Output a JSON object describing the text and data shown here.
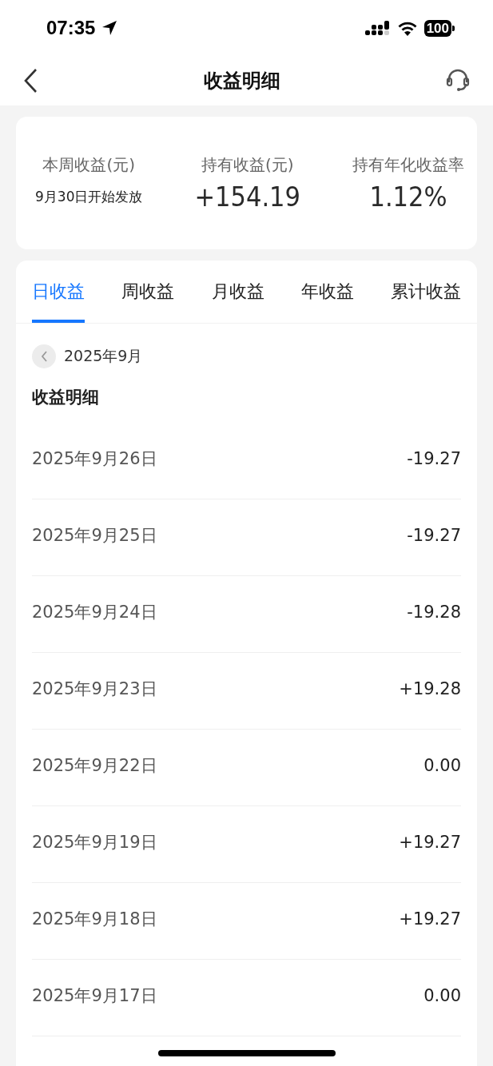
{
  "status_bar": {
    "time": "07:35",
    "battery": "100"
  },
  "nav": {
    "title": "收益明细"
  },
  "summary": [
    {
      "label": "本周收益(元)",
      "value": "9月30日开始发放",
      "kind": "note"
    },
    {
      "label": "持有收益(元)",
      "value": "+154.19",
      "kind": "amount"
    },
    {
      "label": "持有年化收益率",
      "value": "1.12%",
      "kind": "amount"
    }
  ],
  "tabs": [
    {
      "label": "日收益",
      "selected": true
    },
    {
      "label": "周收益",
      "selected": false
    },
    {
      "label": "月收益",
      "selected": false
    },
    {
      "label": "年收益",
      "selected": false
    },
    {
      "label": "累计收益",
      "selected": false
    }
  ],
  "month": "2025年9月",
  "section_title": "收益明细",
  "rows": [
    {
      "date": "2025年9月26日",
      "amount": "-19.27"
    },
    {
      "date": "2025年9月25日",
      "amount": "-19.27"
    },
    {
      "date": "2025年9月24日",
      "amount": "-19.28"
    },
    {
      "date": "2025年9月23日",
      "amount": "+19.28"
    },
    {
      "date": "2025年9月22日",
      "amount": "0.00"
    },
    {
      "date": "2025年9月19日",
      "amount": "+19.27"
    },
    {
      "date": "2025年9月18日",
      "amount": "+19.27"
    },
    {
      "date": "2025年9月17日",
      "amount": "0.00"
    }
  ]
}
